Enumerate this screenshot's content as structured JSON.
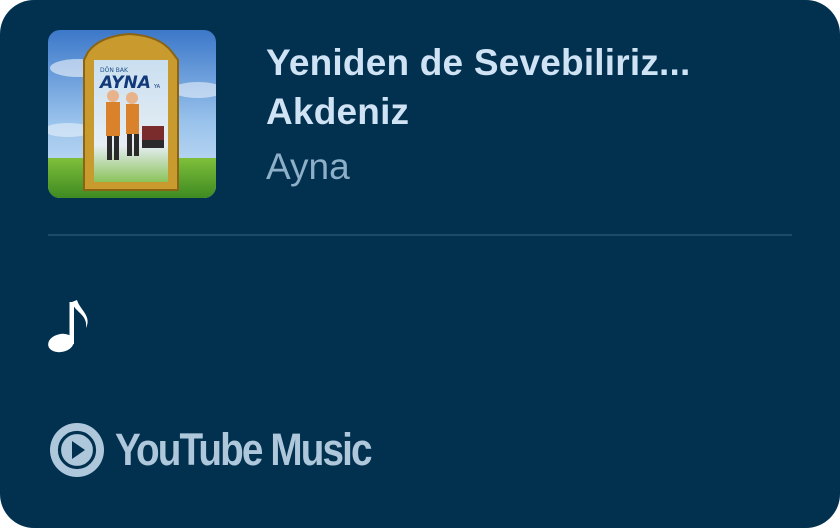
{
  "now_playing": {
    "title_line1": "Yeniden de Sevebiliriz...",
    "title_line2": "Akdeniz",
    "artist": "Ayna"
  },
  "album_art": {
    "small_text": "DÖN BAK",
    "logo_text": "AYNA",
    "suffix_text": "YA"
  },
  "status_icon": "music-note-icon",
  "brand": {
    "icon": "youtube-music-icon",
    "name": "YouTube Music"
  },
  "colors": {
    "background": "#023150",
    "title": "#cfe3f4",
    "subtitle": "#8eafc8",
    "brand": "#aec7db",
    "divider": "#1c4a69"
  }
}
